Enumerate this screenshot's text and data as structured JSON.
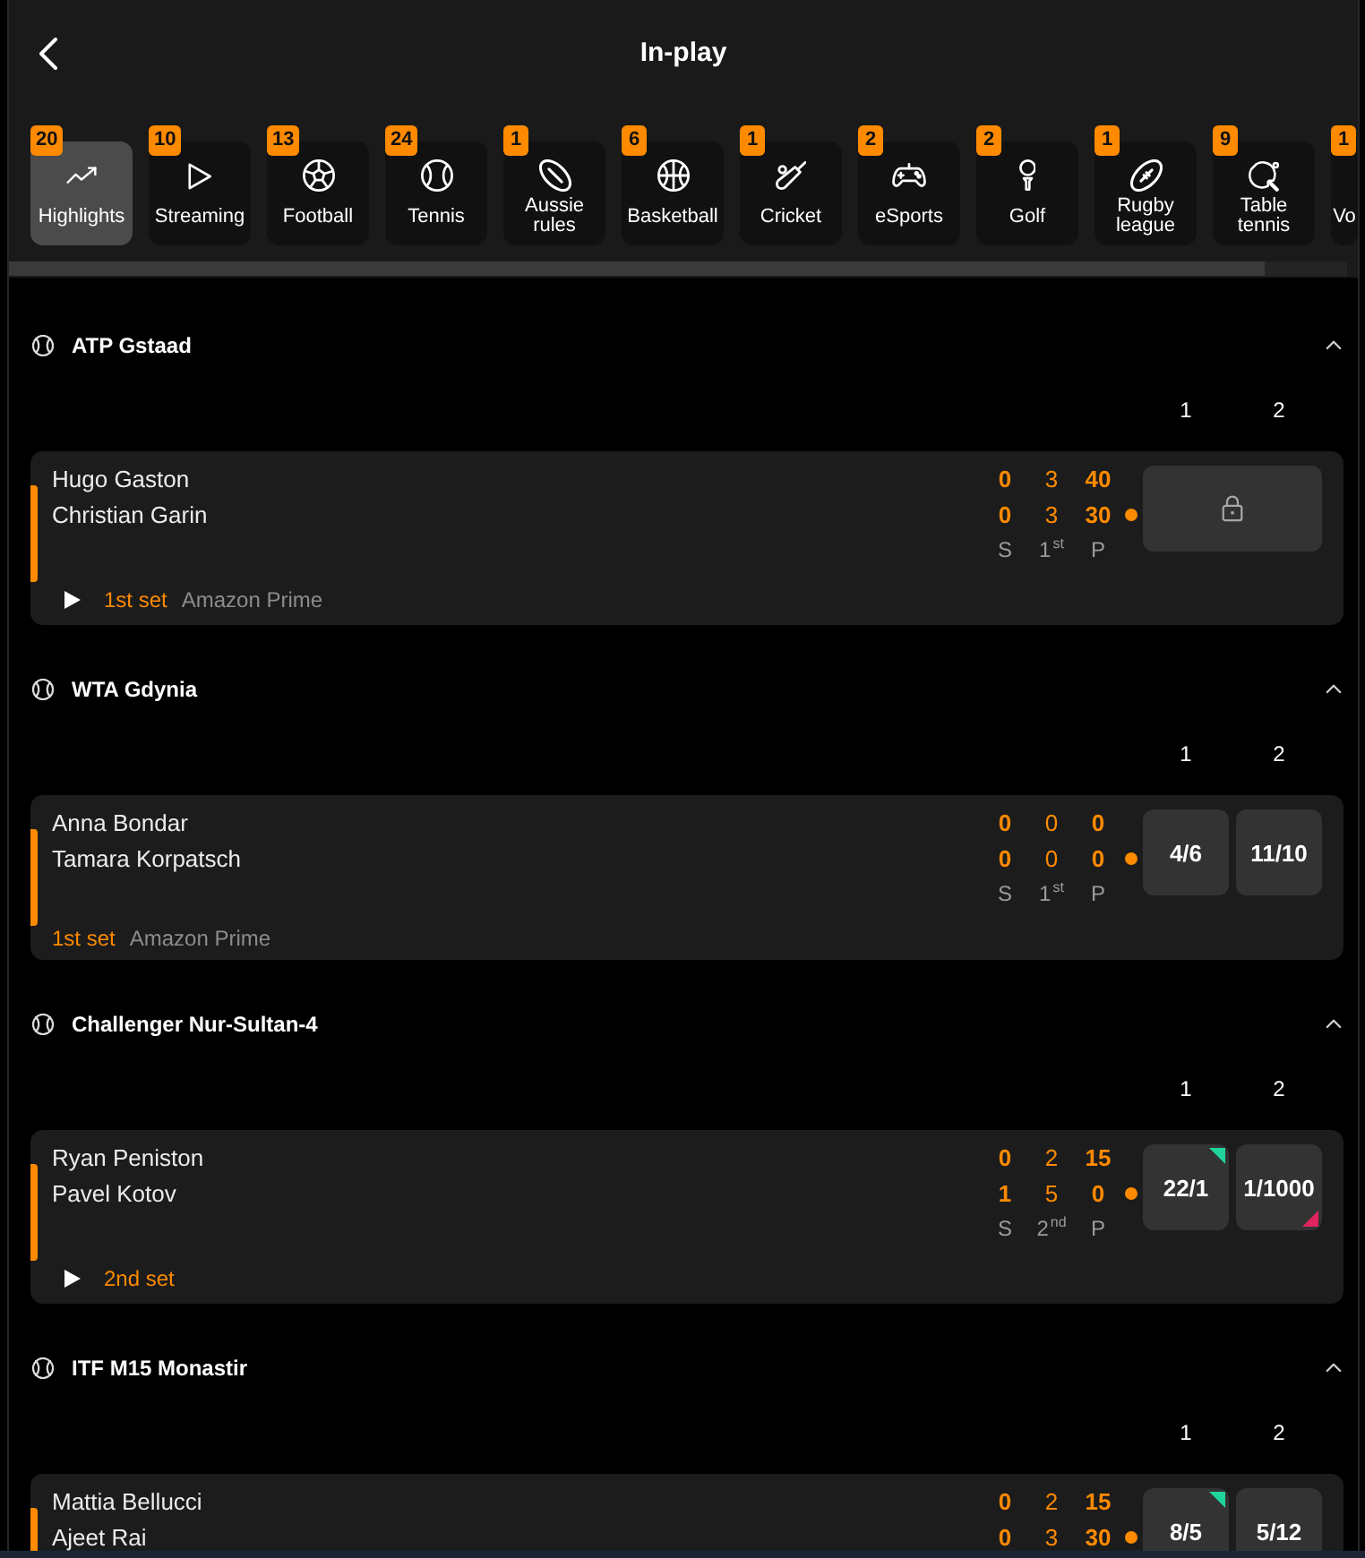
{
  "header": {
    "title": "In-play"
  },
  "sport_tabs": [
    {
      "label": "Highlights",
      "count": "20",
      "selected": true
    },
    {
      "label": "Streaming",
      "count": "10",
      "selected": false
    },
    {
      "label": "Football",
      "count": "13",
      "selected": false
    },
    {
      "label": "Tennis",
      "count": "24",
      "selected": false
    },
    {
      "label": "Aussie rules",
      "count": "1",
      "selected": false
    },
    {
      "label": "Basketball",
      "count": "6",
      "selected": false
    },
    {
      "label": "Cricket",
      "count": "1",
      "selected": false
    },
    {
      "label": "eSports",
      "count": "2",
      "selected": false
    },
    {
      "label": "Golf",
      "count": "2",
      "selected": false
    },
    {
      "label": "Rugby league",
      "count": "1",
      "selected": false
    },
    {
      "label": "Table tennis",
      "count": "9",
      "selected": false
    },
    {
      "label": "Vo",
      "count": "1",
      "selected": false
    }
  ],
  "sections": [
    {
      "title": "ATP Gstaad",
      "expanded": true,
      "columns": [
        "1",
        "2"
      ],
      "events": [
        {
          "players": [
            {
              "name": "Hugo Gaston",
              "sets": "0",
              "games": "3",
              "points": "40",
              "serving": false
            },
            {
              "name": "Christian Garin",
              "sets": "0",
              "games": "3",
              "points": "30",
              "serving": true
            }
          ],
          "score_labels": [
            "S",
            "1$^{st}$",
            "P"
          ],
          "locked": true,
          "streaming": true,
          "period": "1st set",
          "channel": "Amazon Prime"
        }
      ]
    },
    {
      "title": "WTA Gdynia",
      "expanded": true,
      "columns": [
        "1",
        "2"
      ],
      "events": [
        {
          "players": [
            {
              "name": "Anna Bondar",
              "sets": "0",
              "games": "0",
              "points": "0",
              "serving": false
            },
            {
              "name": "Tamara Korpatsch",
              "sets": "0",
              "games": "0",
              "points": "0",
              "serving": true
            }
          ],
          "score_labels": [
            "S",
            "1$^{st}$",
            "P"
          ],
          "locked": false,
          "odds": [
            {
              "value": "4/6",
              "rising": false,
              "falling": false
            },
            {
              "value": "11/10",
              "rising": false,
              "falling": false
            }
          ],
          "streaming": false,
          "period": "1st set",
          "channel": "Amazon Prime"
        }
      ]
    },
    {
      "title": "Challenger Nur-Sultan-4",
      "expanded": true,
      "columns": [
        "1",
        "2"
      ],
      "events": [
        {
          "players": [
            {
              "name": "Ryan Peniston",
              "sets": "0",
              "games": "2",
              "points": "15",
              "serving": false
            },
            {
              "name": "Pavel Kotov",
              "sets": "1",
              "games": "5",
              "points": "0",
              "serving": true
            }
          ],
          "score_labels": [
            "S",
            "2$^{nd}$",
            "P"
          ],
          "locked": false,
          "odds": [
            {
              "value": "22/1",
              "rising": true,
              "falling": false
            },
            {
              "value": "1/1000",
              "rising": false,
              "falling": true
            }
          ],
          "streaming": true,
          "period": "2nd set"
        }
      ]
    },
    {
      "title": "ITF M15 Monastir",
      "expanded": true,
      "columns": [
        "1",
        "2"
      ],
      "events": [
        {
          "players": [
            {
              "name": "Mattia Bellucci",
              "sets": "0",
              "games": "2",
              "points": "15",
              "serving": false
            },
            {
              "name": "Ajeet Rai",
              "sets": "0",
              "games": "3",
              "points": "30",
              "serving": true
            }
          ],
          "locked": false,
          "odds": [
            {
              "value": "8/5",
              "rising": true,
              "falling": false
            },
            {
              "value": "5/12",
              "rising": false,
              "falling": false
            }
          ]
        }
      ]
    }
  ]
}
